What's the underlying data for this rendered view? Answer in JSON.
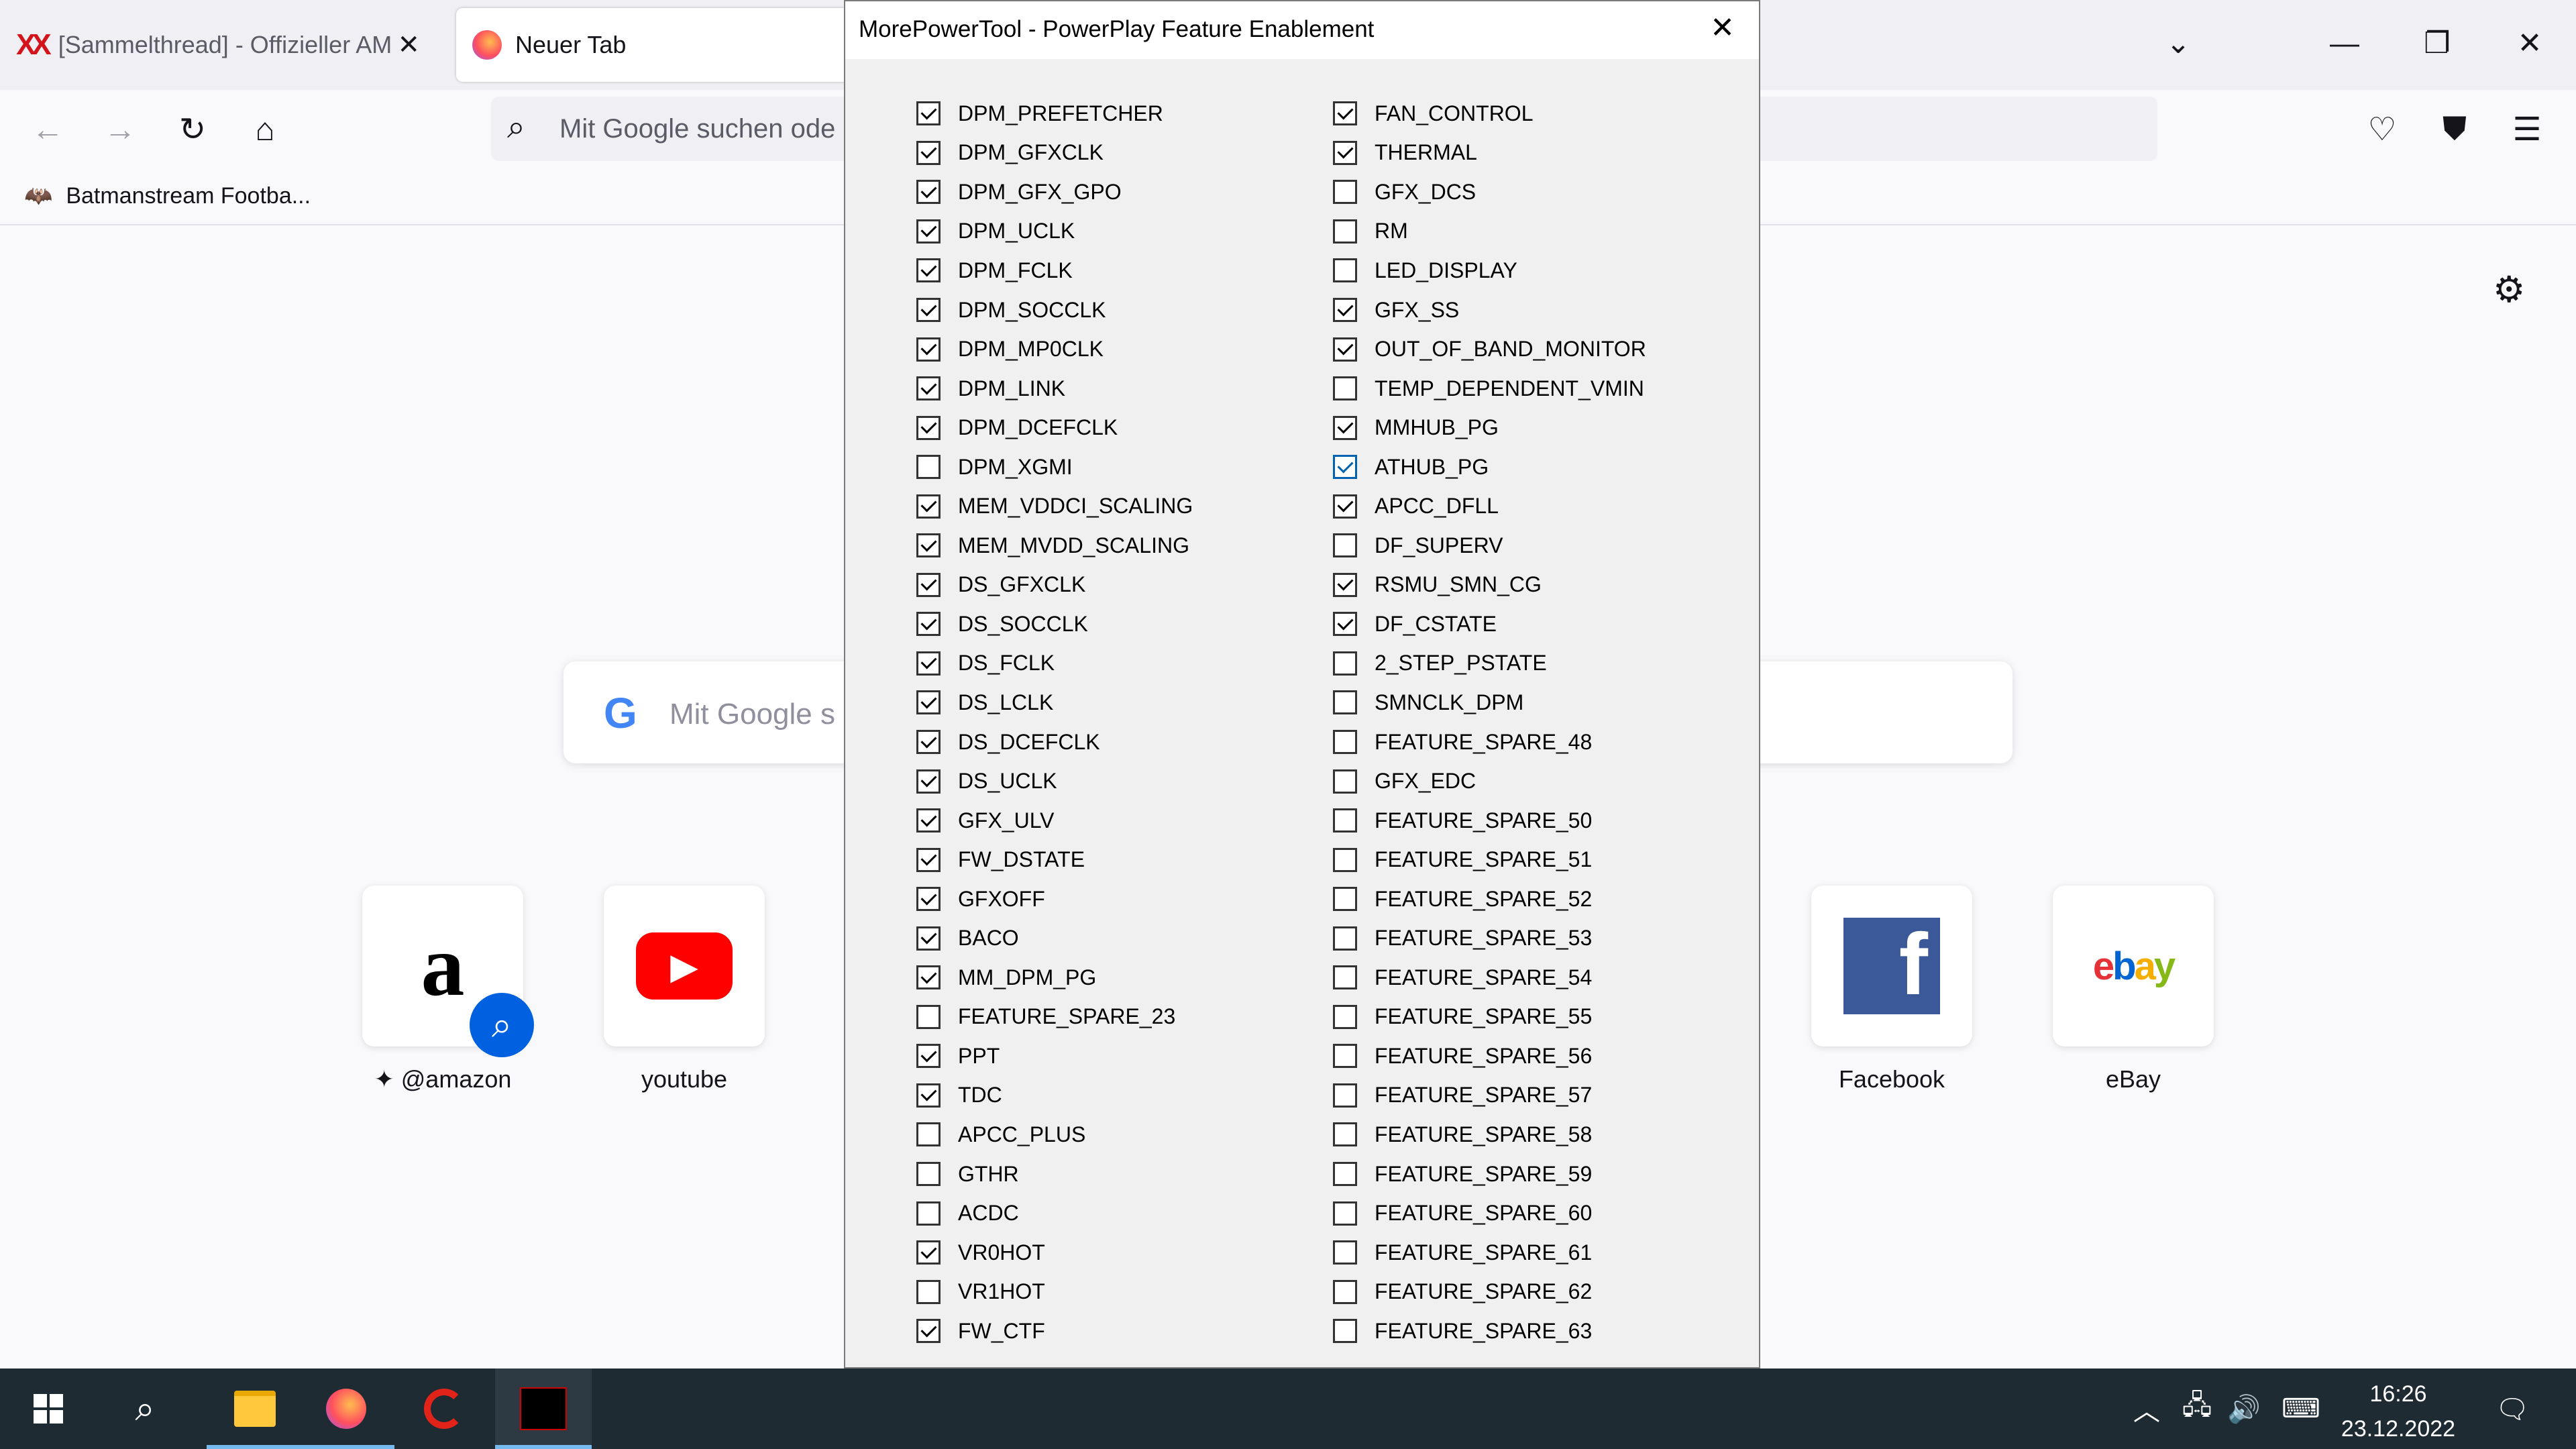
{
  "browser": {
    "tabs": [
      {
        "label": "[Sammelthread] - Offizieller AM"
      },
      {
        "label": "Neuer Tab"
      }
    ],
    "urlbar_placeholder": "Mit Google suchen ode",
    "bookmarks": [
      {
        "label": "Batmanstream Footba..."
      }
    ],
    "search_placeholder": "Mit Google s",
    "top_sites": [
      {
        "label": "@amazon"
      },
      {
        "label": "youtube"
      },
      {
        "label": "Facebook"
      },
      {
        "label": "eBay"
      }
    ]
  },
  "dialog": {
    "title": "MorePowerTool - PowerPlay Feature Enablement",
    "close_label": "✕",
    "left_features": [
      {
        "label": "DPM_PREFETCHER",
        "checked": true
      },
      {
        "label": "DPM_GFXCLK",
        "checked": true
      },
      {
        "label": "DPM_GFX_GPO",
        "checked": true
      },
      {
        "label": "DPM_UCLK",
        "checked": true
      },
      {
        "label": "DPM_FCLK",
        "checked": true
      },
      {
        "label": "DPM_SOCCLK",
        "checked": true
      },
      {
        "label": "DPM_MP0CLK",
        "checked": true
      },
      {
        "label": "DPM_LINK",
        "checked": true
      },
      {
        "label": "DPM_DCEFCLK",
        "checked": true
      },
      {
        "label": "DPM_XGMI",
        "checked": false
      },
      {
        "label": "MEM_VDDCI_SCALING",
        "checked": true
      },
      {
        "label": "MEM_MVDD_SCALING",
        "checked": true
      },
      {
        "label": "DS_GFXCLK",
        "checked": true
      },
      {
        "label": "DS_SOCCLK",
        "checked": true
      },
      {
        "label": "DS_FCLK",
        "checked": true
      },
      {
        "label": "DS_LCLK",
        "checked": true
      },
      {
        "label": "DS_DCEFCLK",
        "checked": true
      },
      {
        "label": "DS_UCLK",
        "checked": true
      },
      {
        "label": "GFX_ULV",
        "checked": true
      },
      {
        "label": "FW_DSTATE",
        "checked": true
      },
      {
        "label": "GFXOFF",
        "checked": true
      },
      {
        "label": "BACO",
        "checked": true
      },
      {
        "label": "MM_DPM_PG",
        "checked": true
      },
      {
        "label": "FEATURE_SPARE_23",
        "checked": false
      },
      {
        "label": "PPT",
        "checked": true
      },
      {
        "label": "TDC",
        "checked": true
      },
      {
        "label": "APCC_PLUS",
        "checked": false
      },
      {
        "label": "GTHR",
        "checked": false
      },
      {
        "label": "ACDC",
        "checked": false
      },
      {
        "label": "VR0HOT",
        "checked": true
      },
      {
        "label": "VR1HOT",
        "checked": false
      },
      {
        "label": "FW_CTF",
        "checked": true
      }
    ],
    "right_features": [
      {
        "label": "FAN_CONTROL",
        "checked": true
      },
      {
        "label": "THERMAL",
        "checked": true
      },
      {
        "label": "GFX_DCS",
        "checked": false
      },
      {
        "label": "RM",
        "checked": false
      },
      {
        "label": "LED_DISPLAY",
        "checked": false
      },
      {
        "label": "GFX_SS",
        "checked": true
      },
      {
        "label": "OUT_OF_BAND_MONITOR",
        "checked": true
      },
      {
        "label": "TEMP_DEPENDENT_VMIN",
        "checked": false
      },
      {
        "label": "MMHUB_PG",
        "checked": true
      },
      {
        "label": "ATHUB_PG",
        "checked": true,
        "focused": true
      },
      {
        "label": "APCC_DFLL",
        "checked": true
      },
      {
        "label": "DF_SUPERV",
        "checked": false
      },
      {
        "label": "RSMU_SMN_CG",
        "checked": true
      },
      {
        "label": "DF_CSTATE",
        "checked": true
      },
      {
        "label": "2_STEP_PSTATE",
        "checked": false
      },
      {
        "label": "SMNCLK_DPM",
        "checked": false
      },
      {
        "label": "FEATURE_SPARE_48",
        "checked": false
      },
      {
        "label": "GFX_EDC",
        "checked": false
      },
      {
        "label": "FEATURE_SPARE_50",
        "checked": false
      },
      {
        "label": "FEATURE_SPARE_51",
        "checked": false
      },
      {
        "label": "FEATURE_SPARE_52",
        "checked": false
      },
      {
        "label": "FEATURE_SPARE_53",
        "checked": false
      },
      {
        "label": "FEATURE_SPARE_54",
        "checked": false
      },
      {
        "label": "FEATURE_SPARE_55",
        "checked": false
      },
      {
        "label": "FEATURE_SPARE_56",
        "checked": false
      },
      {
        "label": "FEATURE_SPARE_57",
        "checked": false
      },
      {
        "label": "FEATURE_SPARE_58",
        "checked": false
      },
      {
        "label": "FEATURE_SPARE_59",
        "checked": false
      },
      {
        "label": "FEATURE_SPARE_60",
        "checked": false
      },
      {
        "label": "FEATURE_SPARE_61",
        "checked": false
      },
      {
        "label": "FEATURE_SPARE_62",
        "checked": false
      },
      {
        "label": "FEATURE_SPARE_63",
        "checked": false
      }
    ]
  },
  "taskbar": {
    "time": "16:26",
    "date": "23.12.2022"
  },
  "colors": {
    "taskbar_bg": "#1f2b33",
    "active_underline": "#76b9ed",
    "focus_checkbox": "#0063b1"
  }
}
